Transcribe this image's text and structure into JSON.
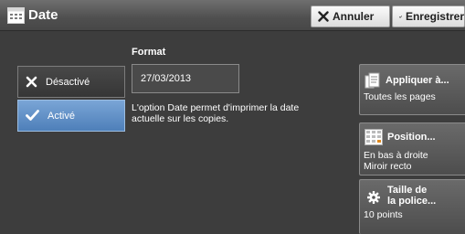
{
  "header": {
    "title": "Date",
    "title_icon": "calendar-icon",
    "cancel_label": "Annuler",
    "save_label": "Enregistrer"
  },
  "format": {
    "label": "Format",
    "value": "27/03/2013",
    "description": "L'option Date permet d'imprimer la date actuelle sur les copies."
  },
  "toggles": {
    "off_label": "Désactivé",
    "on_label": "Activé",
    "selected": "on"
  },
  "options": {
    "apply": {
      "title": "Appliquer à...",
      "value": "Toutes les pages",
      "icon": "pages-icon"
    },
    "position": {
      "title": "Position...",
      "value_line1": "En bas à droite",
      "value_line2": "Miroir recto",
      "icon": "position-grid-icon"
    },
    "font_size": {
      "title_line1": "Taille de",
      "title_line2": "la police...",
      "value": "10 points",
      "icon": "gear-icon"
    }
  },
  "colors": {
    "background": "#3d3d3d",
    "selected_toggle": "#5f8fc8",
    "header": "#555555"
  }
}
